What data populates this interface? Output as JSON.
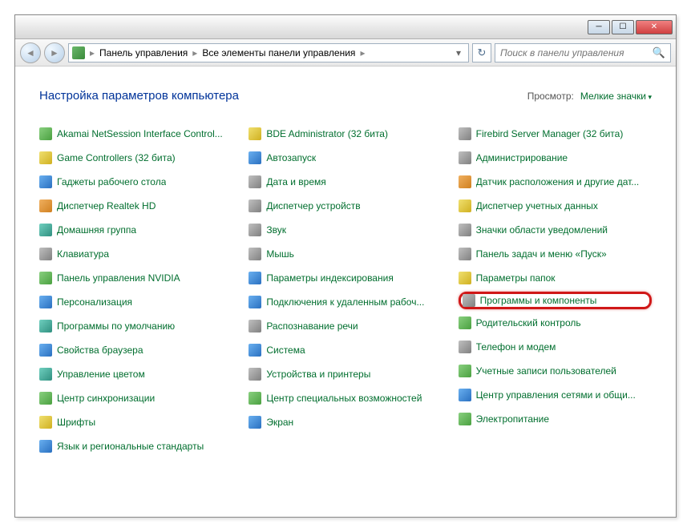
{
  "breadcrumb": {
    "root": "Панель управления",
    "current": "Все элементы панели управления"
  },
  "search": {
    "placeholder": "Поиск в панели управления"
  },
  "page_title": "Настройка параметров компьютера",
  "view": {
    "label": "Просмотр:",
    "value": "Мелкие значки"
  },
  "columns": [
    [
      {
        "label": "Akamai NetSession Interface Control...",
        "icon": "i-green"
      },
      {
        "label": "Game Controllers (32 бита)",
        "icon": "i-yellow"
      },
      {
        "label": "Гаджеты рабочего стола",
        "icon": "i-blue"
      },
      {
        "label": "Диспетчер Realtek HD",
        "icon": "i-orange"
      },
      {
        "label": "Домашняя группа",
        "icon": "i-teal"
      },
      {
        "label": "Клавиатура",
        "icon": "i-gray"
      },
      {
        "label": "Панель управления NVIDIA",
        "icon": "i-green"
      },
      {
        "label": "Персонализация",
        "icon": "i-blue"
      },
      {
        "label": "Программы по умолчанию",
        "icon": "i-teal"
      },
      {
        "label": "Свойства браузера",
        "icon": "i-blue"
      },
      {
        "label": "Управление цветом",
        "icon": "i-teal"
      },
      {
        "label": "Центр синхронизации",
        "icon": "i-green"
      },
      {
        "label": "Шрифты",
        "icon": "i-yellow"
      },
      {
        "label": "Язык и региональные стандарты",
        "icon": "i-blue"
      }
    ],
    [
      {
        "label": "BDE Administrator (32 бита)",
        "icon": "i-yellow"
      },
      {
        "label": "Автозапуск",
        "icon": "i-blue"
      },
      {
        "label": "Дата и время",
        "icon": "i-gray"
      },
      {
        "label": "Диспетчер устройств",
        "icon": "i-gray"
      },
      {
        "label": "Звук",
        "icon": "i-gray"
      },
      {
        "label": "Мышь",
        "icon": "i-gray"
      },
      {
        "label": "Параметры индексирования",
        "icon": "i-blue"
      },
      {
        "label": "Подключения к удаленным рабоч...",
        "icon": "i-blue"
      },
      {
        "label": "Распознавание речи",
        "icon": "i-gray"
      },
      {
        "label": "Система",
        "icon": "i-blue"
      },
      {
        "label": "Устройства и принтеры",
        "icon": "i-gray"
      },
      {
        "label": "Центр специальных возможностей",
        "icon": "i-green"
      },
      {
        "label": "Экран",
        "icon": "i-blue"
      }
    ],
    [
      {
        "label": "Firebird Server Manager (32 бита)",
        "icon": "i-gray"
      },
      {
        "label": "Администрирование",
        "icon": "i-gray"
      },
      {
        "label": "Датчик расположения и другие дат...",
        "icon": "i-orange"
      },
      {
        "label": "Диспетчер учетных данных",
        "icon": "i-yellow"
      },
      {
        "label": "Значки области уведомлений",
        "icon": "i-gray"
      },
      {
        "label": "Панель задач и меню «Пуск»",
        "icon": "i-gray"
      },
      {
        "label": "Параметры папок",
        "icon": "i-yellow"
      },
      {
        "label": "Программы и компоненты",
        "icon": "i-gray",
        "highlight": true
      },
      {
        "label": "Родительский контроль",
        "icon": "i-green"
      },
      {
        "label": "Телефон и модем",
        "icon": "i-gray"
      },
      {
        "label": "Учетные записи пользователей",
        "icon": "i-green"
      },
      {
        "label": "Центр управления сетями и общи...",
        "icon": "i-blue"
      },
      {
        "label": "Электропитание",
        "icon": "i-green"
      }
    ]
  ]
}
